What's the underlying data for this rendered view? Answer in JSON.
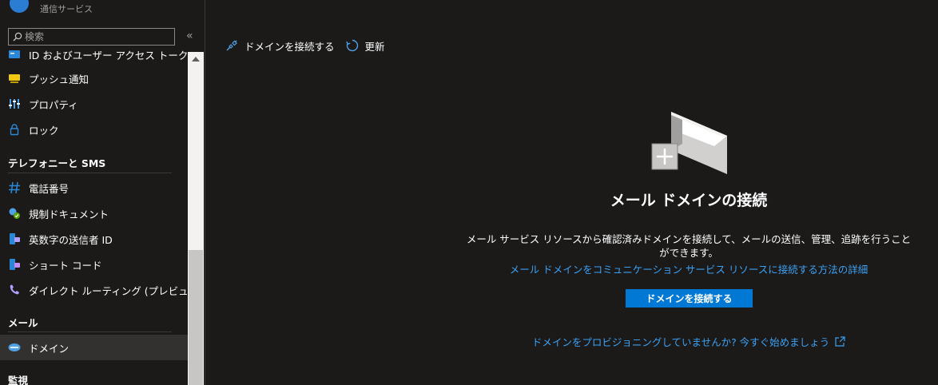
{
  "resource": {
    "subtitle": "通信サービス"
  },
  "sidebar": {
    "search_placeholder": "検索",
    "collapse_glyph": "«",
    "items": [
      {
        "label": "ID およびユーザー アクセス トークン",
        "icon": "id-badge-icon"
      },
      {
        "label": "プッシュ通知",
        "icon": "notification-icon"
      },
      {
        "label": "プロパティ",
        "icon": "properties-icon"
      },
      {
        "label": "ロック",
        "icon": "lock-icon"
      },
      {
        "label": "電話番号",
        "icon": "hashtag-icon"
      },
      {
        "label": "規制ドキュメント",
        "icon": "regulatory-document-icon"
      },
      {
        "label": "英数字の送信者 ID",
        "icon": "alphanumeric-sender-icon"
      },
      {
        "label": "ショート コード",
        "icon": "short-code-icon"
      },
      {
        "label": "ダイレクト ルーティング (プレビュー)",
        "icon": "direct-routing-icon"
      },
      {
        "label": "ドメイン",
        "icon": "domain-icon"
      }
    ],
    "sections": {
      "telephony": "テレフォニーと SMS",
      "email": "メール",
      "monitoring": "監視"
    }
  },
  "toolbar": {
    "connect_label": "ドメインを接続する",
    "refresh_label": "更新"
  },
  "main": {
    "title": "メール ドメインの接続",
    "description": "メール サービス リソースから確認済みドメインを接続して、メールの送信、管理、追跡を行うことができます。",
    "learn_more": "メール ドメインをコミュニケーション サービス リソースに接続する方法の詳細",
    "connect_button": "ドメインを接続する",
    "provision_link": "ドメインをプロビジョニングしていませんか? 今すぐ始めましょう"
  },
  "colors": {
    "background": "#1b1a19",
    "accent": "#0078d4",
    "link": "#3aa0f3",
    "active_item": "#323130"
  }
}
